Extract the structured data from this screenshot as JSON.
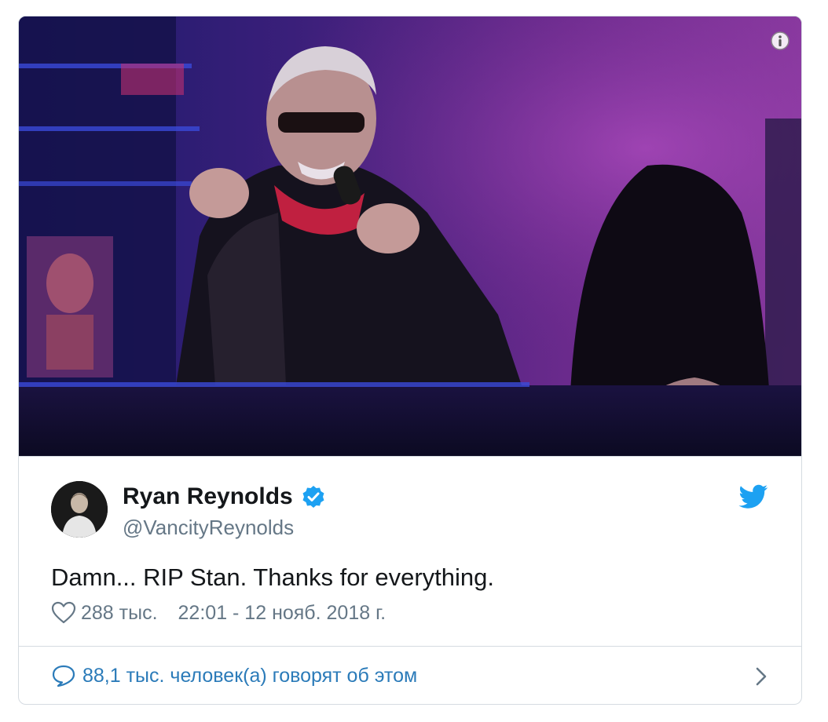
{
  "tweet": {
    "author_name": "Ryan Reynolds",
    "handle": "@VancityReynolds",
    "verified": true,
    "text": "Damn... RIP Stan. Thanks for everything.",
    "likes": "288 тыс.",
    "timestamp": "22:01 - 12 нояб. 2018 г.",
    "conversation": "88,1 тыс. человек(а) говорят об этом"
  },
  "icons": {
    "info": "info-icon",
    "verified": "verified-badge-icon",
    "twitter": "twitter-bird-icon",
    "like": "heart-icon",
    "conversation": "comment-bubble-icon",
    "more": "chevron-right-icon"
  },
  "colors": {
    "text_primary": "#14171a",
    "text_secondary": "#657786",
    "link": "#2b7bb9",
    "twitter_blue": "#1da1f2",
    "border": "#d5dbe1"
  }
}
